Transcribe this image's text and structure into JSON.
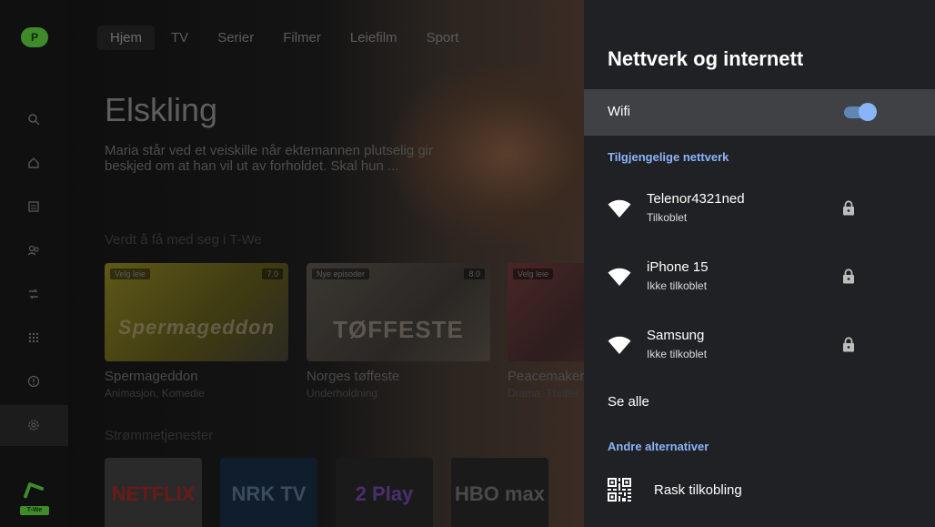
{
  "app": {
    "nav_tabs": [
      "Hjem",
      "TV",
      "Serier",
      "Filmer",
      "Leiefilm",
      "Sport"
    ],
    "profile_initial": "P",
    "brand_label": "T-We",
    "hero": {
      "title": "Elskling",
      "description": "Maria står ved et veiskille når ektemannen plutselig gir beskjed om at han vil ut av forholdet. Skal hun ..."
    },
    "row1_title": "Verdt å få med seg i T-We",
    "cards": [
      {
        "badge": "Velg leie",
        "rating": "7.0",
        "art": "Spermageddon",
        "title": "Spermageddon",
        "subtitle": "Animasjon, Komedie",
        "color": "#6b6320"
      },
      {
        "badge": "Nye episoder",
        "rating": "8.0",
        "art": "TØFFESTE",
        "title": "Norges tøffeste",
        "subtitle": "Underholdning",
        "color": "#3a3530"
      },
      {
        "badge": "Velg leie",
        "rating": "",
        "art": "",
        "title": "Peacemaker",
        "subtitle": "Drama, Thriller",
        "color": "#4a2a2a"
      }
    ],
    "row2_title": "Strømmetjenester",
    "services": [
      {
        "label": "NETFLIX",
        "bg": "#2a2a2a",
        "fg": "#6b1a1a"
      },
      {
        "label": "NRK TV",
        "bg": "#0f1d2d",
        "fg": "#3b4b5e"
      },
      {
        "label": "2 Play",
        "bg": "#1a1a1a",
        "fg": "#4b2e6e"
      },
      {
        "label": "HBO max",
        "bg": "#1a1a1a",
        "fg": "#4a4a4a"
      }
    ]
  },
  "panel": {
    "title": "Nettverk og internett",
    "wifi": {
      "label": "Wifi",
      "enabled": true
    },
    "available_label": "Tilgjengelige nettverk",
    "networks": [
      {
        "name": "Telenor4321ned",
        "status": "Tilkoblet",
        "secured": true,
        "icon": "wifi-icon"
      },
      {
        "name": "iPhone 15",
        "status": "Ikke tilkoblet",
        "secured": true,
        "icon": "wifi-icon"
      },
      {
        "name": "Samsung",
        "status": "Ikke tilkoblet",
        "secured": true,
        "icon": "wifi-icon"
      }
    ],
    "see_all": "Se alle",
    "other_label": "Andre alternativer",
    "quick_connect": {
      "label": "Rask tilkobling",
      "icon": "qr-code-icon"
    },
    "accent_color": "#8ab4f8"
  }
}
